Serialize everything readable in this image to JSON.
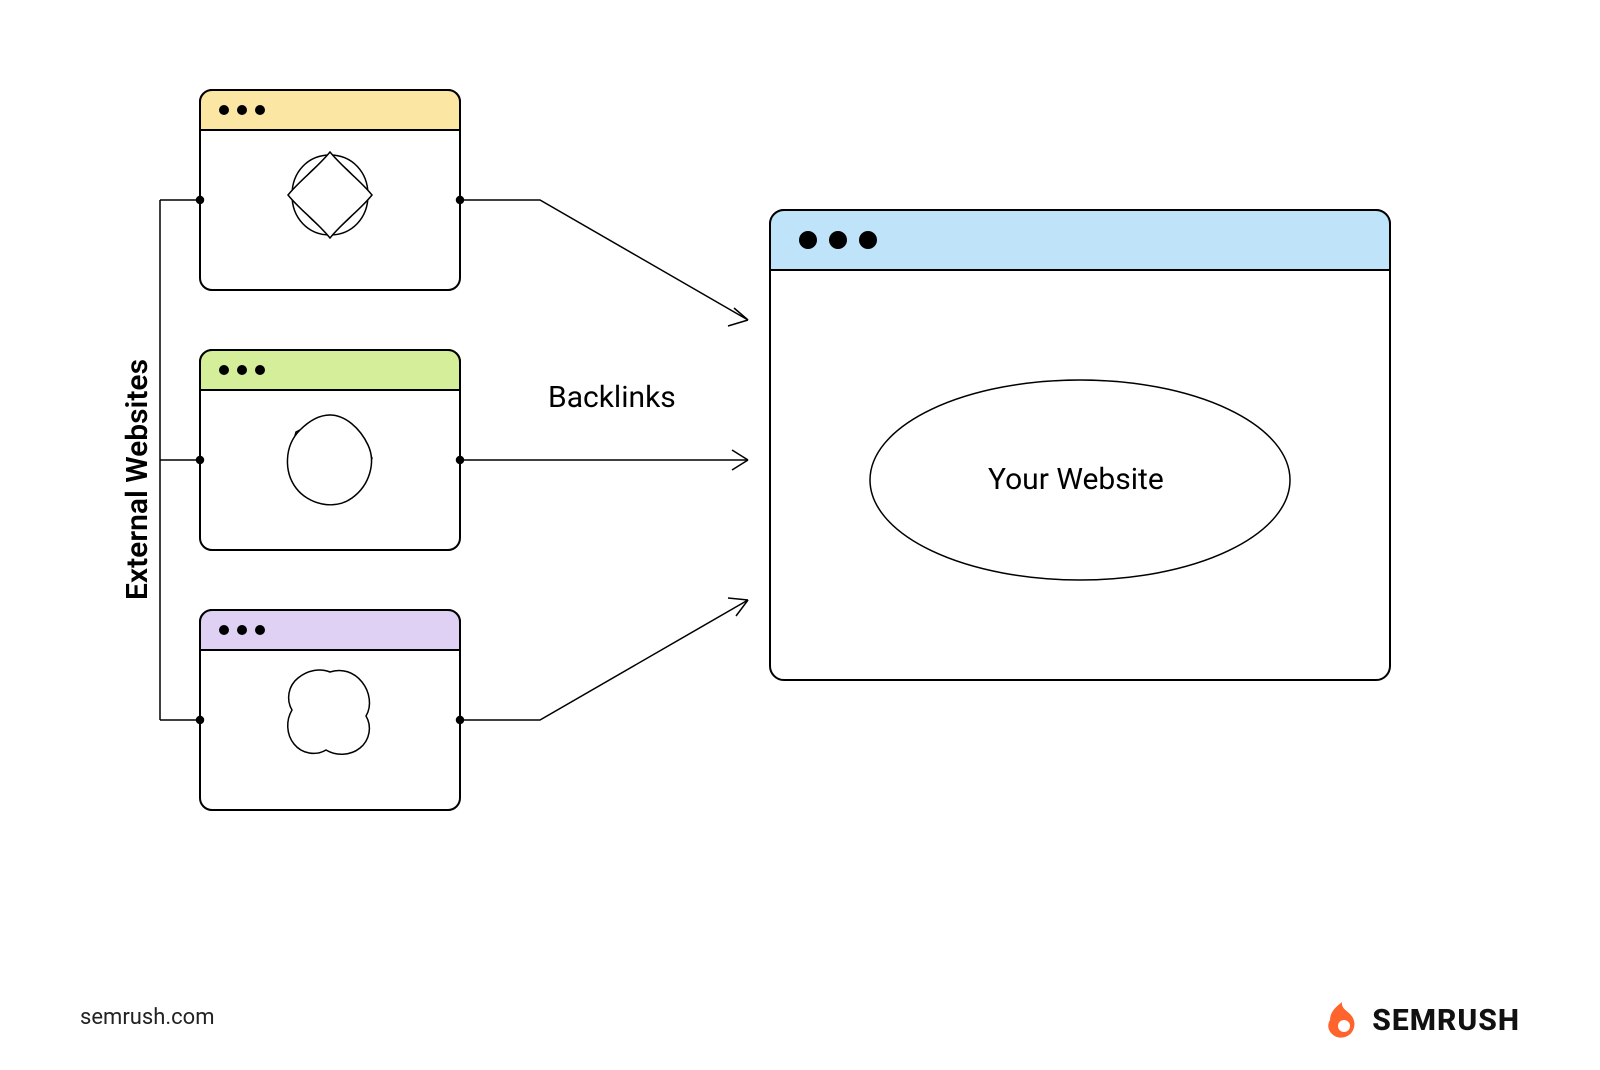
{
  "labels": {
    "external_websites": "External Websites",
    "backlinks": "Backlinks",
    "your_website": "Your Website"
  },
  "footer": {
    "url": "semrush.com",
    "brand": "SEMRUSH"
  },
  "colors": {
    "window1_header": "#FBE7A3",
    "window2_header": "#D5EE9A",
    "window3_header": "#DED1F4",
    "target_header": "#BFE3F8",
    "brand_accent": "#FF642D",
    "stroke": "#000000"
  },
  "diagram": {
    "source_windows": [
      {
        "name": "external-site-1",
        "header_color_key": "window1_header"
      },
      {
        "name": "external-site-2",
        "header_color_key": "window2_header"
      },
      {
        "name": "external-site-3",
        "header_color_key": "window3_header"
      }
    ],
    "target_window": {
      "name": "your-website",
      "header_color_key": "target_header"
    },
    "relation": "backlinks"
  }
}
